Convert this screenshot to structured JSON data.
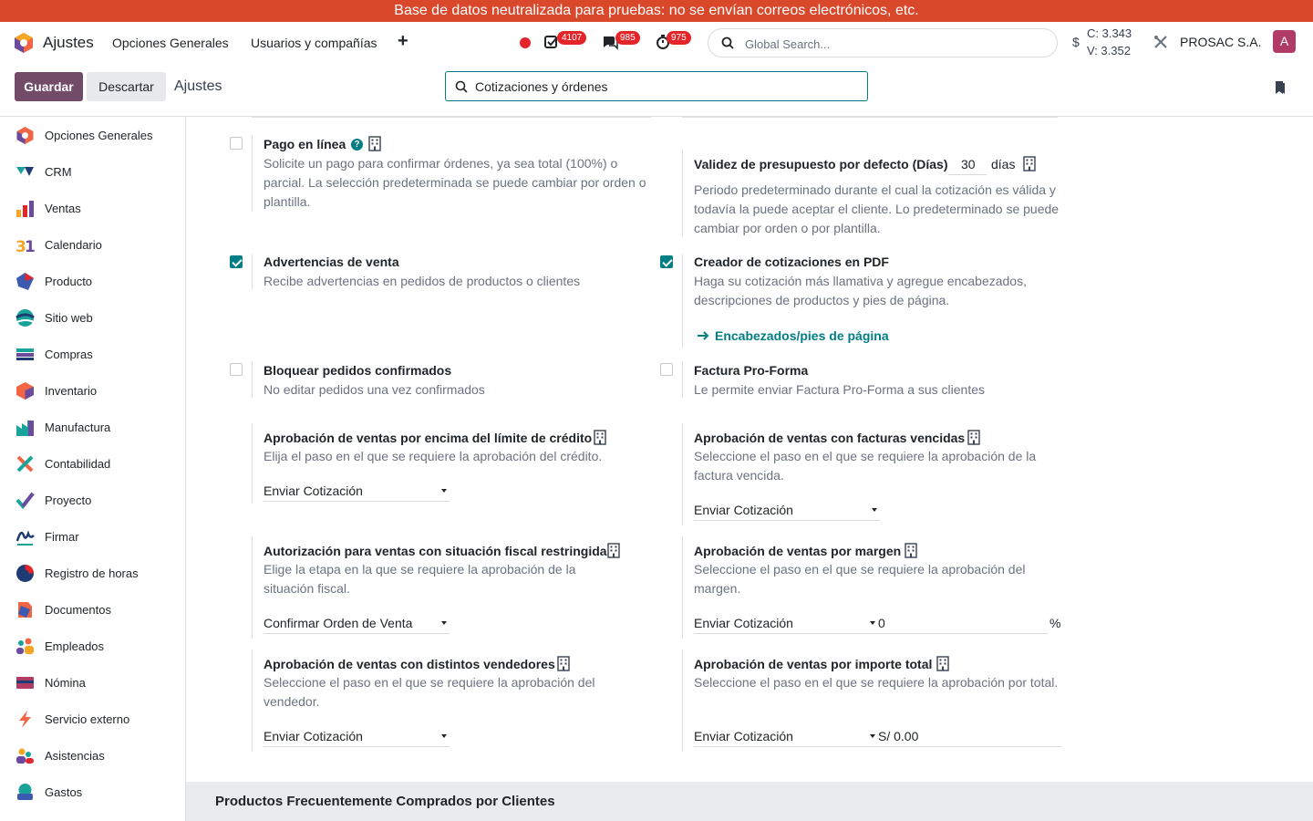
{
  "banner": "Base de datos neutralizada para pruebas: no se envían correos electrónicos, etc.",
  "navbar": {
    "app_name": "Ajustes",
    "menus": [
      "Opciones Generales",
      "Usuarios y compañías"
    ],
    "plus": "+",
    "badges": {
      "activities": "4107",
      "messages": "985",
      "timesheets": "975"
    },
    "search_placeholder": "Global Search...",
    "currency_symbol": "$",
    "rate_c": "C: 3.343",
    "rate_v": "V: 3.352",
    "company": "PROSAC S.A.",
    "avatar_letter": "A"
  },
  "control": {
    "save_label": "Guardar",
    "discard_label": "Descartar",
    "title": "Ajustes",
    "search_value": "Cotizaciones y órdenes"
  },
  "sidebar": {
    "items": [
      {
        "label": "Opciones Generales",
        "icon": "general-settings-icon"
      },
      {
        "label": "CRM",
        "icon": "crm-icon"
      },
      {
        "label": "Ventas",
        "icon": "sales-icon"
      },
      {
        "label": "Calendario",
        "icon": "calendar-icon"
      },
      {
        "label": "Producto",
        "icon": "product-icon"
      },
      {
        "label": "Sitio web",
        "icon": "website-icon"
      },
      {
        "label": "Compras",
        "icon": "purchase-icon"
      },
      {
        "label": "Inventario",
        "icon": "inventory-icon"
      },
      {
        "label": "Manufactura",
        "icon": "manufacturing-icon"
      },
      {
        "label": "Contabilidad",
        "icon": "accounting-icon"
      },
      {
        "label": "Proyecto",
        "icon": "project-icon"
      },
      {
        "label": "Firmar",
        "icon": "sign-icon"
      },
      {
        "label": "Registro de horas",
        "icon": "timesheet-icon"
      },
      {
        "label": "Documentos",
        "icon": "documents-icon"
      },
      {
        "label": "Empleados",
        "icon": "employees-icon"
      },
      {
        "label": "Nómina",
        "icon": "payroll-icon"
      },
      {
        "label": "Servicio externo",
        "icon": "field-service-icon"
      },
      {
        "label": "Asistencias",
        "icon": "attendances-icon"
      },
      {
        "label": "Gastos",
        "icon": "expenses-icon"
      }
    ]
  },
  "settings": {
    "online_payment": {
      "title": "Pago en línea",
      "desc": "Solicite un pago para confirmar órdenes, ya sea total (100%) o parcial. La selección predeterminada se puede cambiar por orden o plantilla.",
      "checked": false
    },
    "quotation_validity": {
      "title": "Validez de presupuesto por defecto (Días)",
      "value": "30",
      "unit": "días",
      "desc": "Periodo predeterminado durante el cual la cotización es válida y todavía la puede aceptar el cliente. Lo predeterminado se puede cambiar por orden o por plantilla."
    },
    "sale_warnings": {
      "title": "Advertencias de venta",
      "desc": "Recibe advertencias en pedidos de productos o clientes",
      "checked": true
    },
    "pdf_builder": {
      "title": "Creador de cotizaciones en PDF",
      "desc": "Haga su cotización más llamativa y agregue encabezados, descripciones de productos y pies de página.",
      "link": "Encabezados/pies de página",
      "checked": true
    },
    "lock_orders": {
      "title": "Bloquear pedidos confirmados",
      "desc": "No editar pedidos una vez confirmados",
      "checked": false
    },
    "proforma": {
      "title": "Factura Pro-Forma",
      "desc": "Le permite enviar Factura Pro-Forma a sus clientes",
      "checked": false
    },
    "credit_limit": {
      "title": "Aprobación de ventas por encima del límite de crédito",
      "desc": "Elija el paso en el que se requiere la aprobación del crédito.",
      "select": "Enviar Cotización"
    },
    "overdue_invoices": {
      "title": "Aprobación de ventas con facturas vencidas",
      "desc": "Seleccione el paso en el que se requiere la aprobación de la factura vencida.",
      "select": "Enviar Cotización"
    },
    "fiscal_restricted": {
      "title": "Autorización para ventas con situación fiscal restringida",
      "desc": "Elige la etapa en la que se requiere la aprobación de la situación fiscal.",
      "select": "Confirmar Orden de Venta"
    },
    "margin": {
      "title": "Aprobación de ventas por margen",
      "desc": "Seleccione el paso en el que se requiere la aprobación del margen.",
      "select": "Enviar Cotización",
      "value": "0",
      "unit": "%"
    },
    "salespersons": {
      "title": "Aprobación de ventas con distintos vendedores",
      "desc": "Seleccione el paso en el que se requiere la aprobación del vendedor.",
      "select": "Enviar Cotización"
    },
    "total_amount": {
      "title": "Aprobación de ventas por importe total",
      "desc": "Seleccione el paso en el que se requiere la aprobación por total.",
      "select": "Enviar Cotización",
      "value": "S/ 0.00"
    }
  },
  "section_header": "Productos Frecuentemente Comprados por Clientes",
  "colors": {
    "banner": "#d9482b",
    "primary": "#714b67",
    "accent": "#017e84",
    "badge": "#e5242a"
  }
}
